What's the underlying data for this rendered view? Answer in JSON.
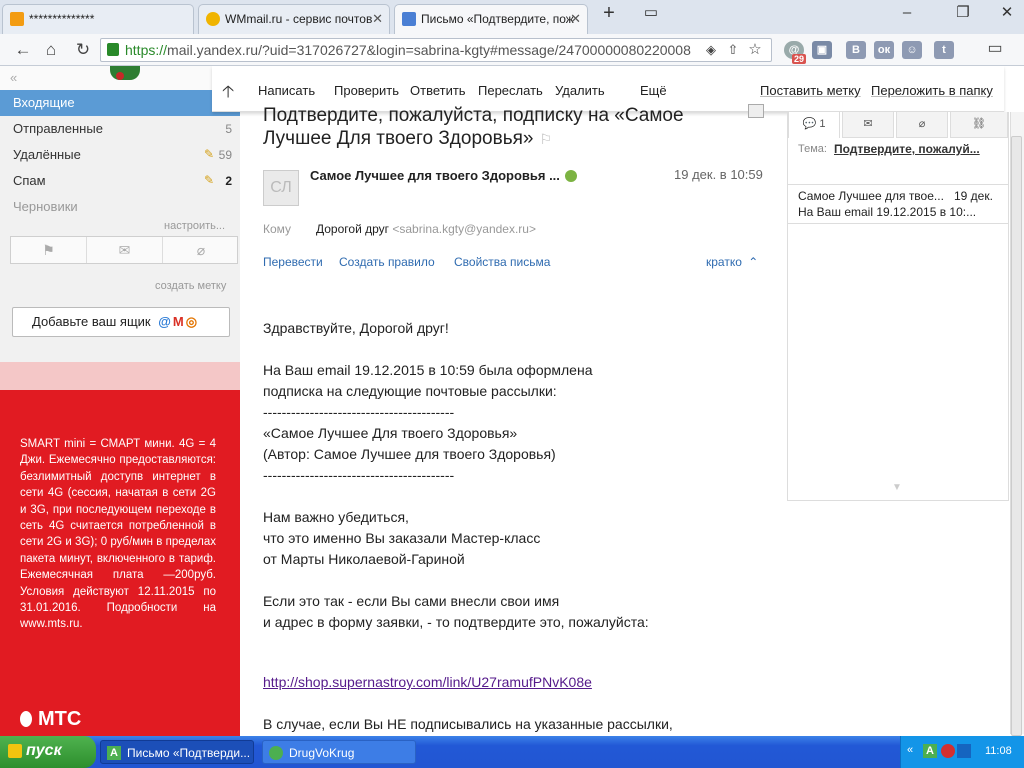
{
  "browser": {
    "tabs": [
      {
        "title": "**************",
        "active": false
      },
      {
        "title": "WMmail.ru - сервис почтов",
        "active": false
      },
      {
        "title": "Письмо «Подтвердите, пож",
        "active": true
      }
    ],
    "url_https": "https://",
    "url_rest": "mail.yandex.ru/?uid=317026727&login=sabrina-kgty#message/24700000080220008",
    "ext_badge": "29",
    "ext_colors": [
      "#888888",
      "#d9534f",
      "#8e9ab3",
      "#8e9ab3",
      "#8e9ab3",
      "#8e9ab3",
      "#8e9ab3"
    ]
  },
  "toolbar": {
    "compose": "Написать",
    "check": "Проверить",
    "reply": "Ответить",
    "forward": "Переслать",
    "delete": "Удалить",
    "more": "Ещё",
    "set_label": "Поставить метку",
    "move_folder": "Переложить в папку"
  },
  "folders": [
    {
      "name": "Входящие",
      "count": ""
    },
    {
      "name": "Отправленные",
      "count": "5"
    },
    {
      "name": "Удалённые",
      "count": "59"
    },
    {
      "name": "Спам",
      "count": "2"
    },
    {
      "name": "Черновики",
      "count": ""
    }
  ],
  "sidebar": {
    "configure": "настроить...",
    "create_label": "создать метку",
    "add_box": "Добавьте ваш ящик"
  },
  "ad": {
    "text": "SMART mini = СМАРТ мини. 4G = 4 Джи. Ежемесячно предоставляются: безлимитный доступв интернет в сети 4G (сессия, начатая в сети 2G и 3G, при последующем переходе в сеть 4G считается потребленной в сети 2G и 3G); 0 руб/мин в пределах пакета минут, включенного в тариф. Ежемесячная плата —200руб. Условия действуют 12.11.2015 по 31.01.2016. Подробности на www.mts.ru.",
    "brand": "МТС"
  },
  "message": {
    "subject": "Подтвердите, пожалуйста, подписку на «Самое Лучшее Для твоего Здоровья»",
    "avatar_initials": "СЛ",
    "sender": "Самое Лучшее для твоего Здоровья ...",
    "date": "19 дек. в 10:59",
    "to_label": "Кому",
    "to_name": "Дорогой друг",
    "to_addr": "<sabrina.kgty@yandex.ru>",
    "actions": [
      "Перевести",
      "Создать правило",
      "Свойства письма"
    ],
    "brief": "кратко",
    "body": "Здравствуйте, Дорогой друг!\n\nНа Ваш email 19.12.2015 в 10:59 была оформлена\nподписка на следующие почтовые рассылки:\n-----------------------------------------\n«Самое Лучшее Для твоего Здоровья»\n(Автор: Самое Лучшее для твоего Здоровья)\n-----------------------------------------\n\nНам важно убедиться,\nчто это именно Вы заказали Мастер-класс\nот Марты Николаевой-Гариной\n\nЕсли это так - если Вы сами внесли свои имя\nи адрес в форму заявки, - то подтвердите это, пожалуйста:",
    "link": "http://shop.supernastroy.com/link/U27ramufPNvK08e",
    "body_tail": "В случае, если Вы НЕ подписывались на указанные рассылки,"
  },
  "panel": {
    "tab_count": "1",
    "topic_label": "Тема:",
    "topic": "Подтвердите, пожалуй...",
    "thread_sender": "Самое Лучшее для твое...",
    "thread_date": "19 дек.",
    "thread_preview": "На Ваш email 19.12.2015 в 10:..."
  },
  "taskbar": {
    "start": "пуск",
    "tasks": [
      "Письмо «Подтверди...",
      "DrugVoKrug"
    ],
    "clock": "11:08"
  }
}
